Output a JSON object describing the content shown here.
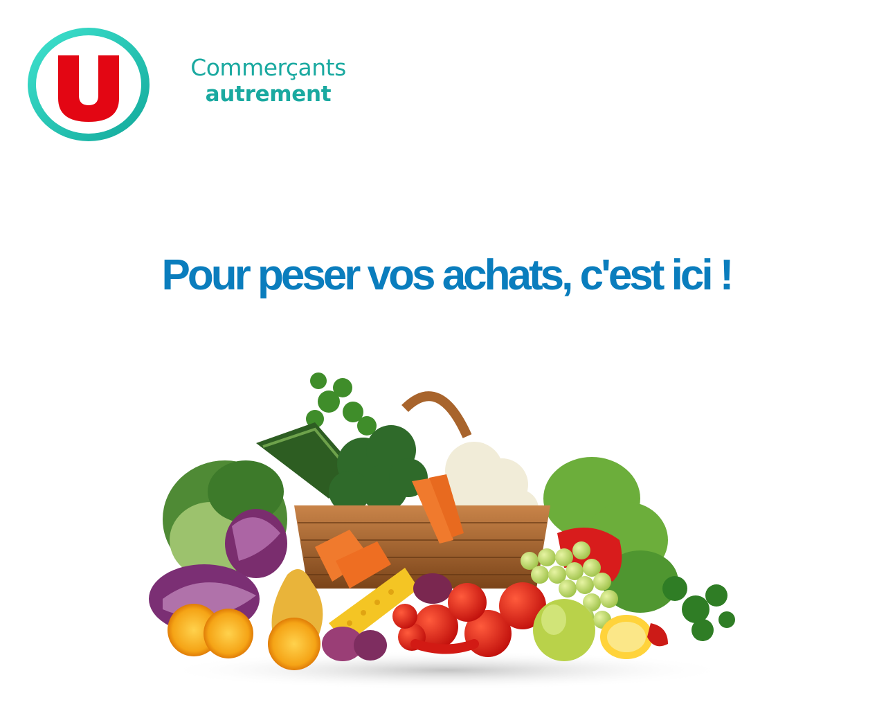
{
  "brand": {
    "logo_icon": "u-logo-icon",
    "tagline_line1": "Commerçants",
    "tagline_line2": "autrement",
    "colors": {
      "red": "#e30613",
      "teal": "#1aa9a0",
      "ring_light": "#3fe3cf"
    }
  },
  "main": {
    "headline": "Pour peser vos achats, c'est ici !",
    "headline_color": "#0a7dbd",
    "hero_image": "vegetable-basket-image"
  }
}
